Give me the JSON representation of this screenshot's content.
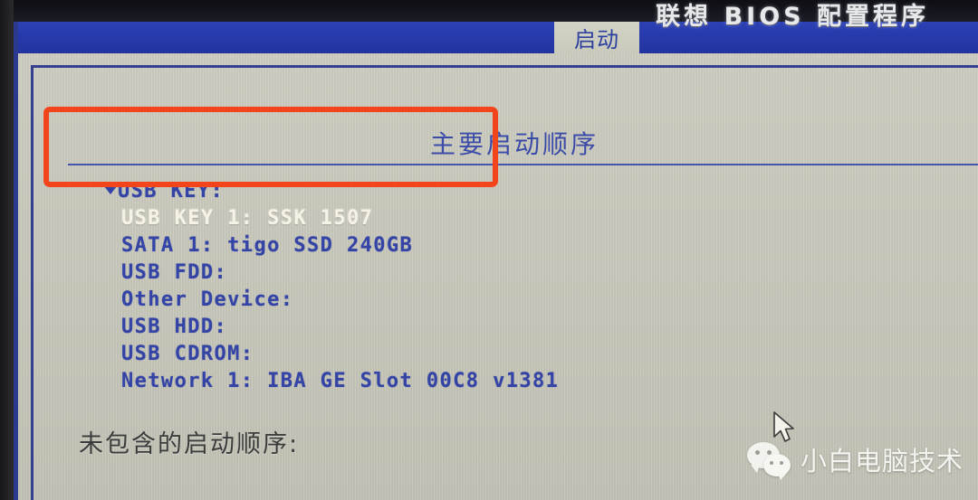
{
  "header": {
    "title": "联想 BIOS 配置程序"
  },
  "tabs": [
    {
      "label": "启动",
      "active": true
    }
  ],
  "main": {
    "section_title": "主要启动顺序",
    "excluded_label": "未包含的启动顺序:",
    "boot_order": [
      {
        "label": "USB KEY:",
        "level": 0,
        "expanded": true,
        "selected": false
      },
      {
        "label": "USB KEY 1: SSK 1507",
        "level": 1,
        "expanded": false,
        "selected": true
      },
      {
        "label": "SATA 1: tigo SSD 240GB",
        "level": 1,
        "expanded": false,
        "selected": false
      },
      {
        "label": "USB FDD:",
        "level": 1,
        "expanded": false,
        "selected": false
      },
      {
        "label": "Other Device:",
        "level": 1,
        "expanded": false,
        "selected": false
      },
      {
        "label": "USB HDD:",
        "level": 1,
        "expanded": false,
        "selected": false
      },
      {
        "label": "USB CDROM:",
        "level": 1,
        "expanded": false,
        "selected": false
      },
      {
        "label": "Network 1: IBA GE Slot 00C8 v1381",
        "level": 1,
        "expanded": false,
        "selected": false
      }
    ]
  },
  "annotation": {
    "shape": "rectangle",
    "color": "#f2451c",
    "covers": "USB KEY: and USB KEY 1: SSK 1507"
  },
  "watermark": {
    "text": "小白电脑技术",
    "logo": "wechat-logo"
  },
  "cursor": {
    "icon": "mouse-pointer-arrow"
  },
  "colors": {
    "tab_bar_blue": "#2739a9",
    "panel_beige": "#c9c9bc",
    "text_blue": "#3444a6",
    "selected_text": "#f6f3e6",
    "annotation_red": "#f2451c",
    "header_bg": "#15151d"
  }
}
